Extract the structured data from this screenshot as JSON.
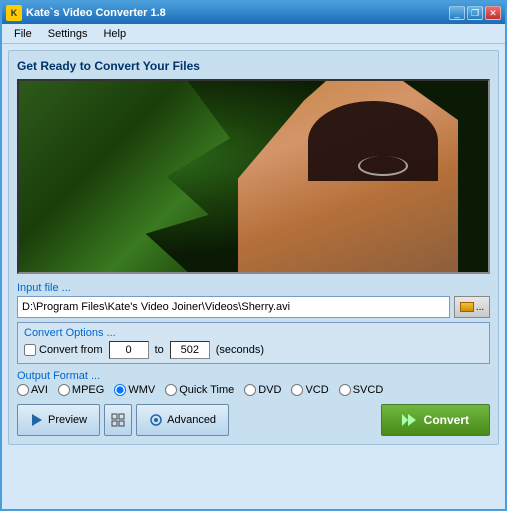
{
  "window": {
    "title": "Kate`s Video Converter 1.8",
    "icon_label": "K"
  },
  "menu": {
    "items": [
      "File",
      "Settings",
      "Help"
    ]
  },
  "main": {
    "section_title": "Get Ready to Convert Your Files",
    "input_section": {
      "label": "Input file ...",
      "file_path": "D:\\Program Files\\Kate's Video Joiner\\Videos\\Sherry.avi",
      "browse_label": "..."
    },
    "convert_options": {
      "label": "Convert Options ...",
      "checkbox_label": "Convert from",
      "from_value": "0",
      "to_value": "502",
      "seconds_label": "(seconds)"
    },
    "output_format": {
      "label": "Output Format ...",
      "options": [
        "AVI",
        "MPEG",
        "WMV",
        "Quick Time",
        "DVD",
        "VCD",
        "SVCD"
      ],
      "selected": "WMV"
    },
    "buttons": {
      "preview_label": "Preview",
      "advanced_label": "Advanced",
      "convert_label": "Convert"
    }
  },
  "title_buttons": {
    "minimize": "_",
    "restore": "❐",
    "close": "✕"
  }
}
